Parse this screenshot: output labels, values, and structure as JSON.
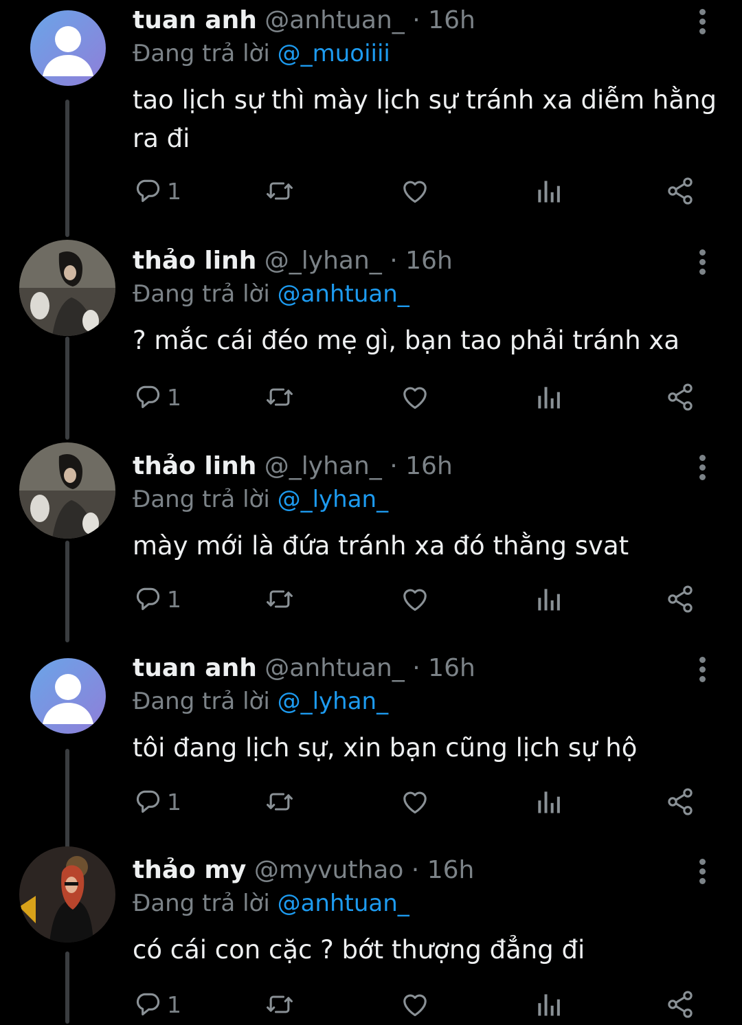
{
  "colors": {
    "background": "#000000",
    "text": "#e7e9ea",
    "muted": "#7c8388",
    "mention": "#1d9bf0",
    "thread_line": "#3a3d40"
  },
  "icons": {
    "reply": "comment-icon",
    "retweet": "retweet-icon",
    "like": "heart-icon",
    "views": "views-chart-icon",
    "share": "share-icon",
    "more": "more-vertical-icon"
  },
  "tweets": [
    {
      "name": "tuan anh",
      "handle": "@anhtuan_",
      "dot": "·",
      "time": "16h",
      "reply_prefix": "Đang trả lời",
      "reply_to": "@_muoiiii",
      "text": "tao lịch sự thì mày lịch sự tránh xa diễm hằng ra đi",
      "reply_count": "1",
      "avatar": "default-avatar"
    },
    {
      "name": "thảo linh",
      "handle": "@_lyhan_",
      "dot": "·",
      "time": "16h",
      "reply_prefix": "Đang trả lời",
      "reply_to": "@anhtuan_",
      "text": "? mắc cái đéo mẹ gì, bạn tao phải tránh xa",
      "reply_count": "1",
      "avatar": "photo-avatar"
    },
    {
      "name": "thảo linh",
      "handle": "@_lyhan_",
      "dot": "·",
      "time": "16h",
      "reply_prefix": "Đang trả lời",
      "reply_to": "@_lyhan_",
      "text": "mày mới là đứa tránh xa đó thằng svat",
      "reply_count": "1",
      "avatar": "photo-avatar"
    },
    {
      "name": "tuan anh",
      "handle": "@anhtuan_",
      "dot": "·",
      "time": "16h",
      "reply_prefix": "Đang trả lời",
      "reply_to": "@_lyhan_",
      "text": "tôi đang lịch sự, xin bạn cũng lịch sự hộ",
      "reply_count": "1",
      "avatar": "default-avatar"
    },
    {
      "name": "thảo my",
      "handle": "@myvuthao",
      "dot": "·",
      "time": "16h",
      "reply_prefix": "Đang trả lời",
      "reply_to": "@anhtuan_",
      "text": "có cái con cặc ? bớt thượng đẳng đi",
      "reply_count": "1",
      "avatar": "photo-avatar"
    }
  ]
}
